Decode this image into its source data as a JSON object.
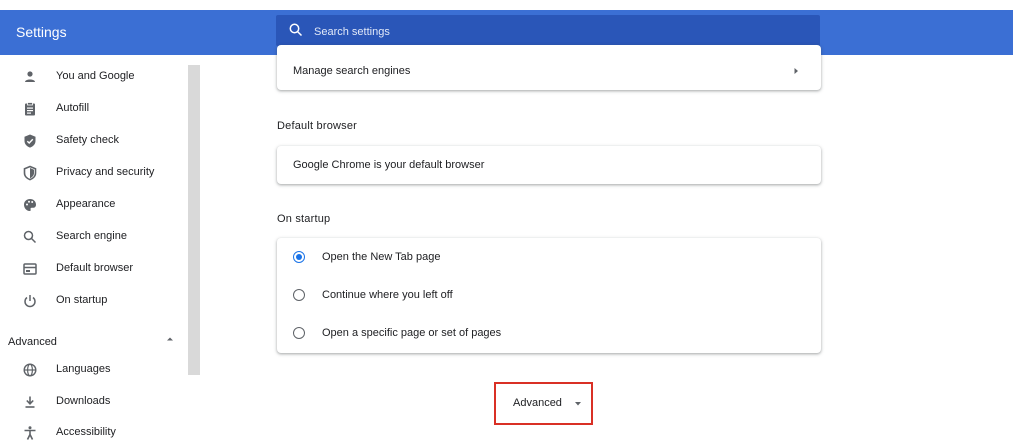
{
  "header": {
    "title": "Settings",
    "search_placeholder": "Search settings"
  },
  "sidebar": {
    "items": [
      {
        "label": "You and Google",
        "icon": "person-icon"
      },
      {
        "label": "Autofill",
        "icon": "clipboard-icon"
      },
      {
        "label": "Safety check",
        "icon": "shield-check-icon"
      },
      {
        "label": "Privacy and security",
        "icon": "shield-icon"
      },
      {
        "label": "Appearance",
        "icon": "palette-icon"
      },
      {
        "label": "Search engine",
        "icon": "search-icon"
      },
      {
        "label": "Default browser",
        "icon": "browser-icon"
      },
      {
        "label": "On startup",
        "icon": "power-icon"
      }
    ],
    "advanced_label": "Advanced",
    "advanced_items": [
      {
        "label": "Languages",
        "icon": "globe-icon"
      },
      {
        "label": "Downloads",
        "icon": "download-icon"
      },
      {
        "label": "Accessibility",
        "icon": "accessibility-icon"
      }
    ]
  },
  "main": {
    "manage_search_engines": "Manage search engines",
    "default_browser_title": "Default browser",
    "default_browser_status": "Google Chrome is your default browser",
    "on_startup_title": "On startup",
    "startup_options": [
      {
        "label": "Open the New Tab page",
        "selected": true
      },
      {
        "label": "Continue where you left off",
        "selected": false
      },
      {
        "label": "Open a specific page or set of pages",
        "selected": false
      }
    ],
    "advanced_button": "Advanced"
  },
  "colors": {
    "header_bg": "#3b6fd4",
    "search_bg": "#2a56b8",
    "accent": "#1a73e8",
    "highlight_border": "#d93025"
  }
}
